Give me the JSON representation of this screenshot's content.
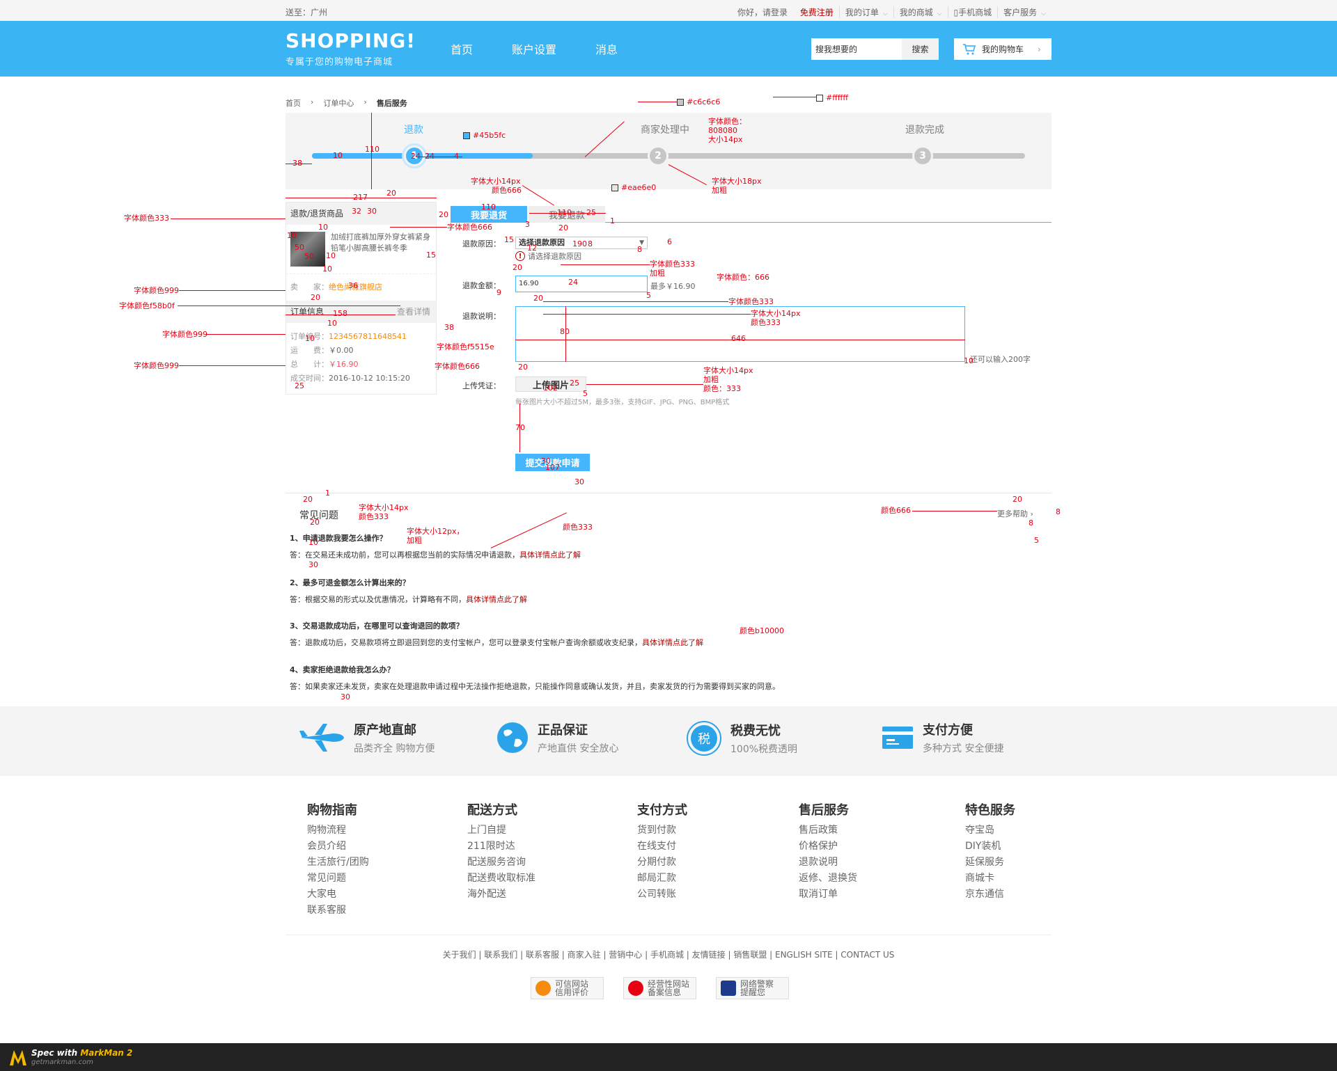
{
  "topbar": {
    "location": "送至：广州",
    "greeting": "你好，请登录",
    "register": "免费注册",
    "my_orders": "我的订单",
    "my_mall": "我的商城",
    "mobile_mall": "手机商城",
    "customer_service": "客户服务"
  },
  "header": {
    "logo": "SHOPPING!",
    "slogan": "专属于您的购物电子商城",
    "nav": [
      "首页",
      "账户设置",
      "消息"
    ],
    "search_placeholder": "搜我想要的",
    "search_button": "搜索",
    "cart": "我的购物车"
  },
  "breadcrumb": [
    "首页",
    "订单中心",
    "售后服务"
  ],
  "progress": {
    "steps": [
      {
        "label": "退款",
        "num": "1"
      },
      {
        "label": "商家处理中",
        "num": "2"
      },
      {
        "label": "退款完成",
        "num": "3"
      }
    ],
    "active_step": 1,
    "fill_fraction": 0.31
  },
  "sidebar": {
    "goods_header": "退款/退货商品",
    "goods_name": "加绒打底裤加厚外穿女裤紧身铅笔小脚高腰长裤冬季",
    "shop_label": "卖　　家：",
    "shop_name": "绝色尚雅旗舰店",
    "order_header": "订单信息",
    "order_detail_link": "查看详情",
    "order_no_label": "订单编号：",
    "order_no": "1234567811648541",
    "freight_label": "运　　费：",
    "freight": "￥0.00",
    "total_label": "总　　计：",
    "total": "￥16.90",
    "time_label": "成交时间：",
    "time": "2016-10-12 10:15:20"
  },
  "tabs": {
    "refund_return": "我要退货",
    "refund_only": "我要退款"
  },
  "form": {
    "reason_label": "退款原因：",
    "reason_value": "选择退款原因",
    "reason_warning": "请选择退款原因",
    "amount_label": "退款金额：",
    "amount_value": "16.90",
    "amount_hint": "最多￥16.90",
    "desc_label": "退款说明：",
    "desc_hint": "还可以输入200字",
    "upload_label": "上传凭证：",
    "upload_button": "上传图片",
    "upload_hint": "每张图片大小不超过5M，最多3张，支持GIF、JPG、PNG、BMP格式",
    "submit": "提交退款申请"
  },
  "faq": {
    "title": "常见问题",
    "more": "更多帮助",
    "items": [
      {
        "q": "1、申请退款我要怎么操作？",
        "a": "答：在交易还未成功前，您可以再根据您当前的实际情况申请退款，",
        "link": "具体详情点此了解"
      },
      {
        "q": "2、最多可退金额怎么计算出来的？",
        "a": "答：根据交易的形式以及优惠情况，计算略有不同，",
        "link": "具体详情点此了解"
      },
      {
        "q": "3、交易退款成功后，在哪里可以查询退回的款项？",
        "a": "答：退款成功后，交易款项将立即退回到您的支付宝帐户，您可以登录支付宝帐户查询余额或收支纪录，",
        "link": "具体详情点此了解"
      },
      {
        "q": "4、卖家拒绝退款给我怎么办？",
        "a": "答：如果卖家还未发货，卖家在处理退款申请过程中无法操作拒绝退款，只能操作同意或确认发货，并且，卖家发货的行为需要得到买家的同意。",
        "link": ""
      }
    ]
  },
  "features": [
    {
      "icon": "plane-icon",
      "title": "原产地直邮",
      "sub": "品类齐全 购物方便"
    },
    {
      "icon": "globe-icon",
      "title": "正品保证",
      "sub": "产地直供 安全放心"
    },
    {
      "icon": "tax-icon",
      "title": "税费无忧",
      "sub": "100%税费透明"
    },
    {
      "icon": "card-icon",
      "title": "支付方便",
      "sub": "多种方式 安全便捷"
    }
  ],
  "footer_cols": [
    {
      "h": "购物指南",
      "items": [
        "购物流程",
        "会员介绍",
        "生活旅行/团购",
        "常见问题",
        "大家电",
        "联系客服"
      ]
    },
    {
      "h": "配送方式",
      "items": [
        "上门自提",
        "211限时达",
        "配送服务咨询",
        "配送费收取标准",
        "海外配送"
      ]
    },
    {
      "h": "支付方式",
      "items": [
        "货到付款",
        "在线支付",
        "分期付款",
        "邮局汇款",
        "公司转账"
      ]
    },
    {
      "h": "售后服务",
      "items": [
        "售后政策",
        "价格保护",
        "退款说明",
        "返修、退换货",
        "取消订单"
      ]
    },
    {
      "h": "特色服务",
      "items": [
        "夺宝岛",
        "DIY装机",
        "延保服务",
        "商城卡",
        "京东通信"
      ]
    }
  ],
  "footer_links": "关于我们 | 联系我们 | 联系客服 | 商家入驻 | 营销中心 | 手机商城 | 友情链接 | 销售联盟 | ENGLISH SITE | CONTACT US",
  "badges": [
    {
      "l1": "可信网站",
      "l2": "信用评价",
      "color": "#f58b0f"
    },
    {
      "l1": "经营性网站",
      "l2": "备案信息",
      "color": "#e60012"
    },
    {
      "l1": "网络警察",
      "l2": "提醒您",
      "color": "#1e3a8a"
    }
  ],
  "markman": {
    "l1a": "Spec with ",
    "l1b": "MarkMan 2",
    "l2": "getmarkman.com"
  },
  "annotations": {
    "c6": "#c6c6c6",
    "ff": "#ffffff",
    "blue": "#45b5fc",
    "eae": "#eae6e0",
    "step_font": "字体颜色：",
    "step_font2": "808080",
    "step_font3": "大小14px",
    "num_font": "字体大小18px",
    "num_font2": "加粗",
    "tab_font": "字体大小14px",
    "tab_font2": "颜色666",
    "c333a": "字体颜色333",
    "c666a": "字体颜色666",
    "c999a": "字体颜色999",
    "cf58": "字体颜色f58b0f",
    "c999b": "字体颜色999",
    "cf5": "字体颜色f5515e",
    "c999c": "字体颜色999",
    "c666b": "字体颜色666",
    "sel333": "字体颜色333",
    "sel333b": "加粗",
    "c666c": "字体颜色：666",
    "c333b": "字体颜色333",
    "ta14": "字体大小14px",
    "ta333": "颜色333",
    "up14": "字体大小14px",
    "upb": "加粗",
    "up333": "颜色：333",
    "faq14": "字体大小14px",
    "faq333": "颜色333",
    "q12": "字体大小12px，",
    "q12b": "加粗",
    "a333": "颜色333",
    "b10": "颜色b10000",
    "more666": "颜色666",
    "n38": "38",
    "n10a": "10",
    "n110": "110",
    "n24a": "24",
    "n24b": "24",
    "n4": "4",
    "n217": "217",
    "n20a": "20",
    "n32": "32",
    "n30a": "30",
    "n110b": "110",
    "n20b": "20",
    "n110c": "110",
    "n25a": "25",
    "n1a": "1",
    "n3": "3",
    "n20c": "20",
    "n10b": "10",
    "n10c": "10",
    "n50a": "50",
    "n50b": "50",
    "n10d": "10",
    "n15a": "15",
    "n10e": "10",
    "n36": "36",
    "n20d": "20",
    "n158": "158",
    "n10f": "10",
    "n38b": "38",
    "n10g": "10",
    "n25b": "25",
    "n15b": "15",
    "n12": "12",
    "n190": "190",
    "n8a": "8",
    "n6": "6",
    "n8b": "8",
    "n20e": "20",
    "n9": "9",
    "n24c": "24",
    "n5a": "5",
    "n20f": "20",
    "n80": "80",
    "n646": "646",
    "n10h": "10",
    "n20g": "20",
    "n25c": "25",
    "n102": "102",
    "n5b": "5",
    "n70": "70",
    "n30b": "30",
    "n107": "107",
    "n30c": "30",
    "n20h": "20",
    "n1b": "1",
    "n20i": "20",
    "n10i": "10",
    "n30d": "30",
    "n20j": "20",
    "n8c": "8",
    "n8d": "8",
    "n5c": "5",
    "n30e": "30"
  }
}
